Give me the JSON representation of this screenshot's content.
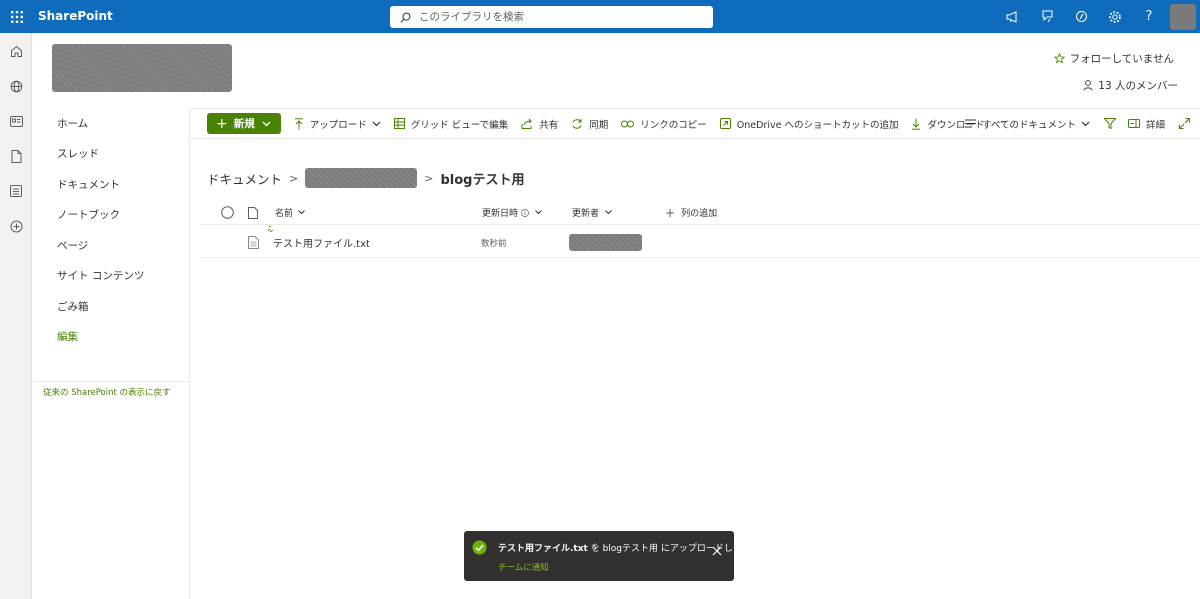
{
  "app": {
    "brand": "SharePoint"
  },
  "search": {
    "placeholder": "このライブラリを検索"
  },
  "site": {
    "follow_label": "フォローしていません",
    "members_label": "13 人のメンバー"
  },
  "nav": {
    "items": [
      {
        "label": "ホーム"
      },
      {
        "label": "スレッド"
      },
      {
        "label": "ドキュメント"
      },
      {
        "label": "ノートブック"
      },
      {
        "label": "ページ"
      },
      {
        "label": "サイト コンテンツ"
      },
      {
        "label": "ごみ箱"
      },
      {
        "label": "編集"
      }
    ],
    "return_link": "従来の SharePoint の表示に戻す"
  },
  "commands": {
    "new": "新規",
    "upload": "アップロード",
    "grid_edit": "グリッド ビューで編集",
    "share": "共有",
    "sync": "同期",
    "copy_link": "リンクのコピー",
    "onedrive_shortcut": "OneDrive へのショートカットの追加",
    "download": "ダウンロード",
    "more": "···",
    "view": "すべてのドキュメント",
    "details": "詳細"
  },
  "breadcrumb": {
    "root": "ドキュメント",
    "current": "blogテスト用"
  },
  "table": {
    "headers": {
      "name": "名前",
      "modified": "更新日時",
      "modified_by": "更新者",
      "add_column": "列の追加"
    },
    "rows": [
      {
        "name": "テスト用ファイル.txt",
        "modified": "数秒前"
      }
    ]
  },
  "toast": {
    "file": "テスト用ファイル.txt",
    "mid": " を ",
    "folder": "blogテスト用",
    "tail": " にアップロードしました",
    "link": "チームに通知"
  },
  "colors": {
    "header": "#0f6cbd",
    "accent": "#498205",
    "toast_bg": "#323130",
    "toast_link": "#8cbd18"
  }
}
